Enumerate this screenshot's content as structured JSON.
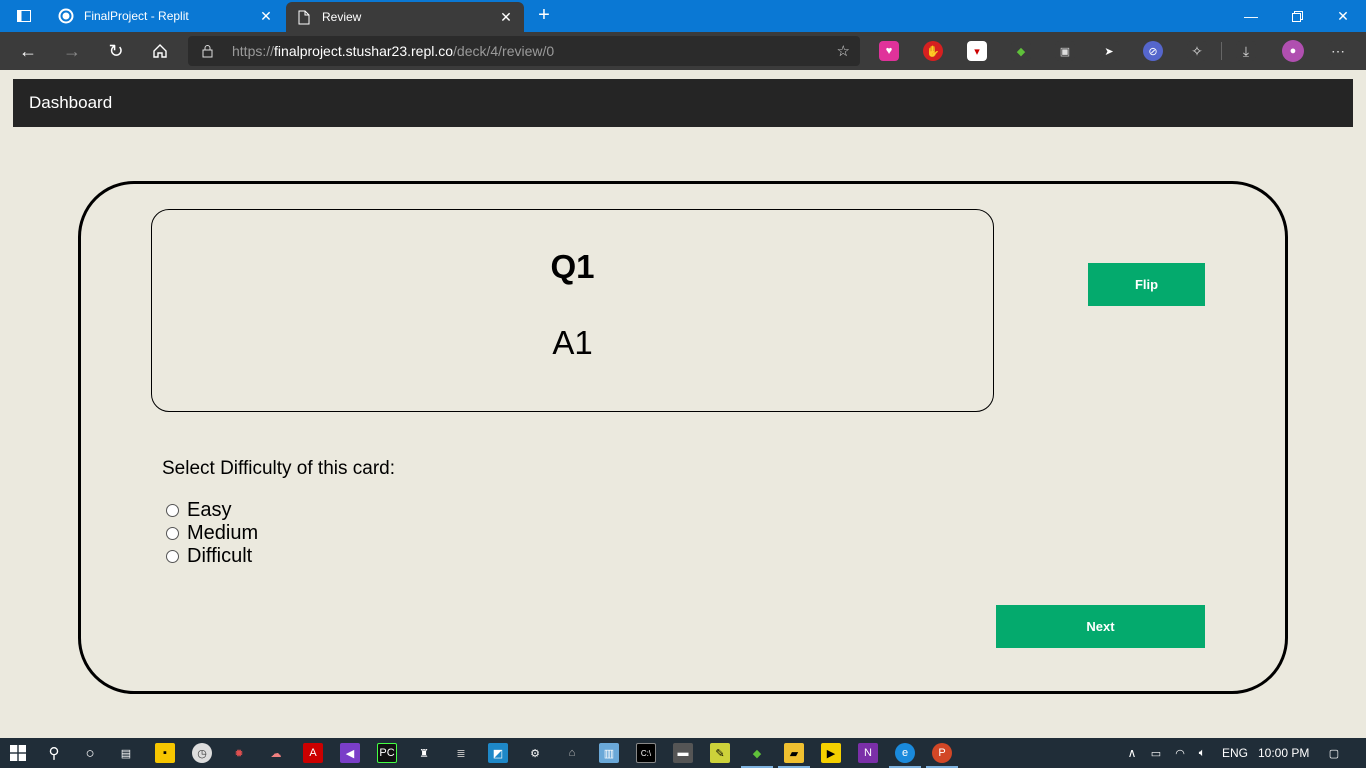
{
  "browser": {
    "tabs": [
      {
        "title": "FinalProject - Replit",
        "icon": "replit-icon"
      },
      {
        "title": "Review",
        "icon": "page-icon"
      }
    ],
    "url": {
      "scheme": "https://",
      "host": "finalproject.stushar23.repl.co",
      "path": "/deck/4/review/0"
    }
  },
  "navbar": {
    "brand": "Dashboard"
  },
  "card": {
    "question": "Q1",
    "answer": "A1"
  },
  "buttons": {
    "flip": "Flip",
    "next": "Next"
  },
  "difficulty": {
    "label": "Select Difficulty of this card:",
    "options": [
      "Easy",
      "Medium",
      "Difficult"
    ]
  },
  "taskbar": {
    "language": "ENG",
    "time": "10:00 PM"
  },
  "colors": {
    "accent": "#04aa6d",
    "page_bg": "#ebe9de",
    "navbar_bg": "#252525",
    "titlebar": "#0a78d4"
  }
}
